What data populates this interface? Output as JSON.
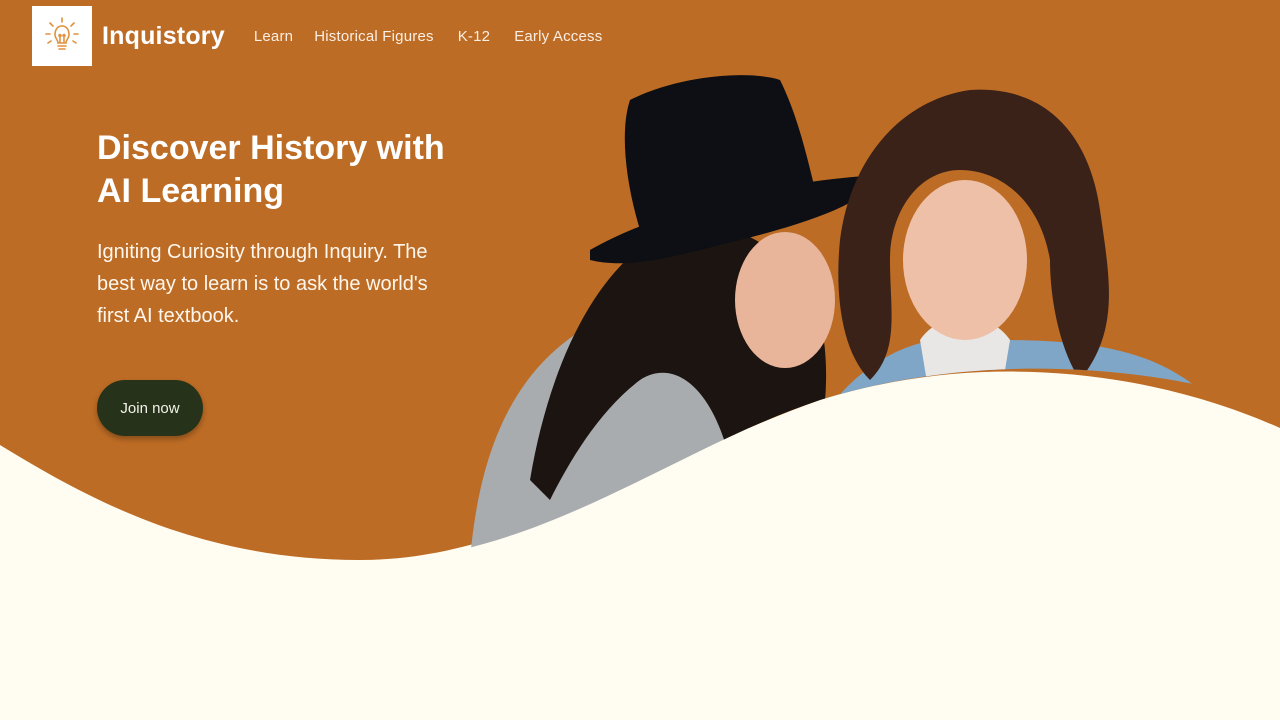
{
  "brand": {
    "name": "Inquistory",
    "logo_icon": "lightbulb-icon"
  },
  "nav": {
    "items": [
      {
        "label": "Learn"
      },
      {
        "label": "Historical Figures"
      },
      {
        "label": "K-12"
      },
      {
        "label": "Early Access"
      }
    ]
  },
  "hero": {
    "title": "Discover History with AI Learning",
    "subtitle": "Igniting Curiosity through Inquiry. The best way to learn is to ask the world's first AI textbook.",
    "cta_label": "Join now"
  },
  "colors": {
    "hero_bg": "#bd6c25",
    "page_bg": "#fffcf1",
    "button_bg": "#26331a",
    "logo_accent": "#e0913f"
  }
}
